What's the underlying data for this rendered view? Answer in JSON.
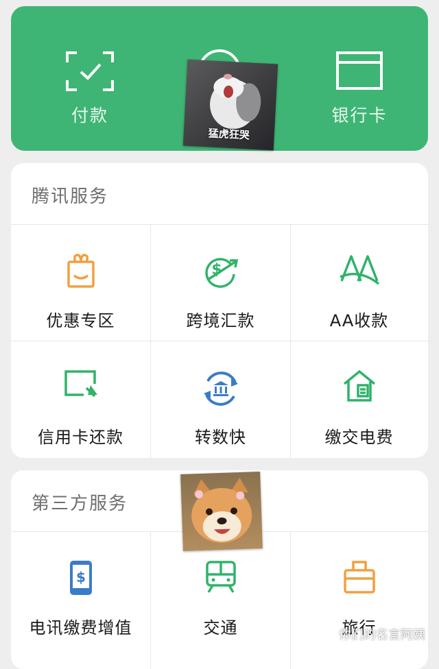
{
  "banner": {
    "pay_label": "付款",
    "bank_label": "银行卡"
  },
  "tencent_services": {
    "title": "腾讯服务",
    "items": [
      {
        "label": "优惠专区",
        "icon": "gift-bag-icon",
        "color": "#f0a040"
      },
      {
        "label": "跨境汇款",
        "icon": "global-dollar-icon",
        "color": "#2fb36a"
      },
      {
        "label": "AA收款",
        "icon": "aa-icon",
        "color": "#2fb36a"
      },
      {
        "label": "信用卡还款",
        "icon": "credit-card-icon",
        "color": "#2fb36a"
      },
      {
        "label": "转数快",
        "icon": "bank-cycle-icon",
        "color": "#3a7cc7"
      },
      {
        "label": "缴交电费",
        "icon": "house-bill-icon",
        "color": "#2fb36a"
      }
    ]
  },
  "third_party_services": {
    "title": "第三方服务",
    "items": [
      {
        "label": "电讯缴费增值",
        "icon": "phone-dollar-icon",
        "color": "#3a7cc7"
      },
      {
        "label": "交通",
        "icon": "train-icon",
        "color": "#2fb36a"
      },
      {
        "label": "旅行",
        "icon": "luggage-icon",
        "color": "#f0a040"
      }
    ]
  },
  "stickers": {
    "cat_caption": "猛虎狂哭"
  },
  "watermark": {
    "text": "你们的名言阿姨"
  },
  "colors": {
    "brand_green": "#3eb574",
    "accent_orange": "#f0a040",
    "accent_blue": "#3a7cc7"
  }
}
